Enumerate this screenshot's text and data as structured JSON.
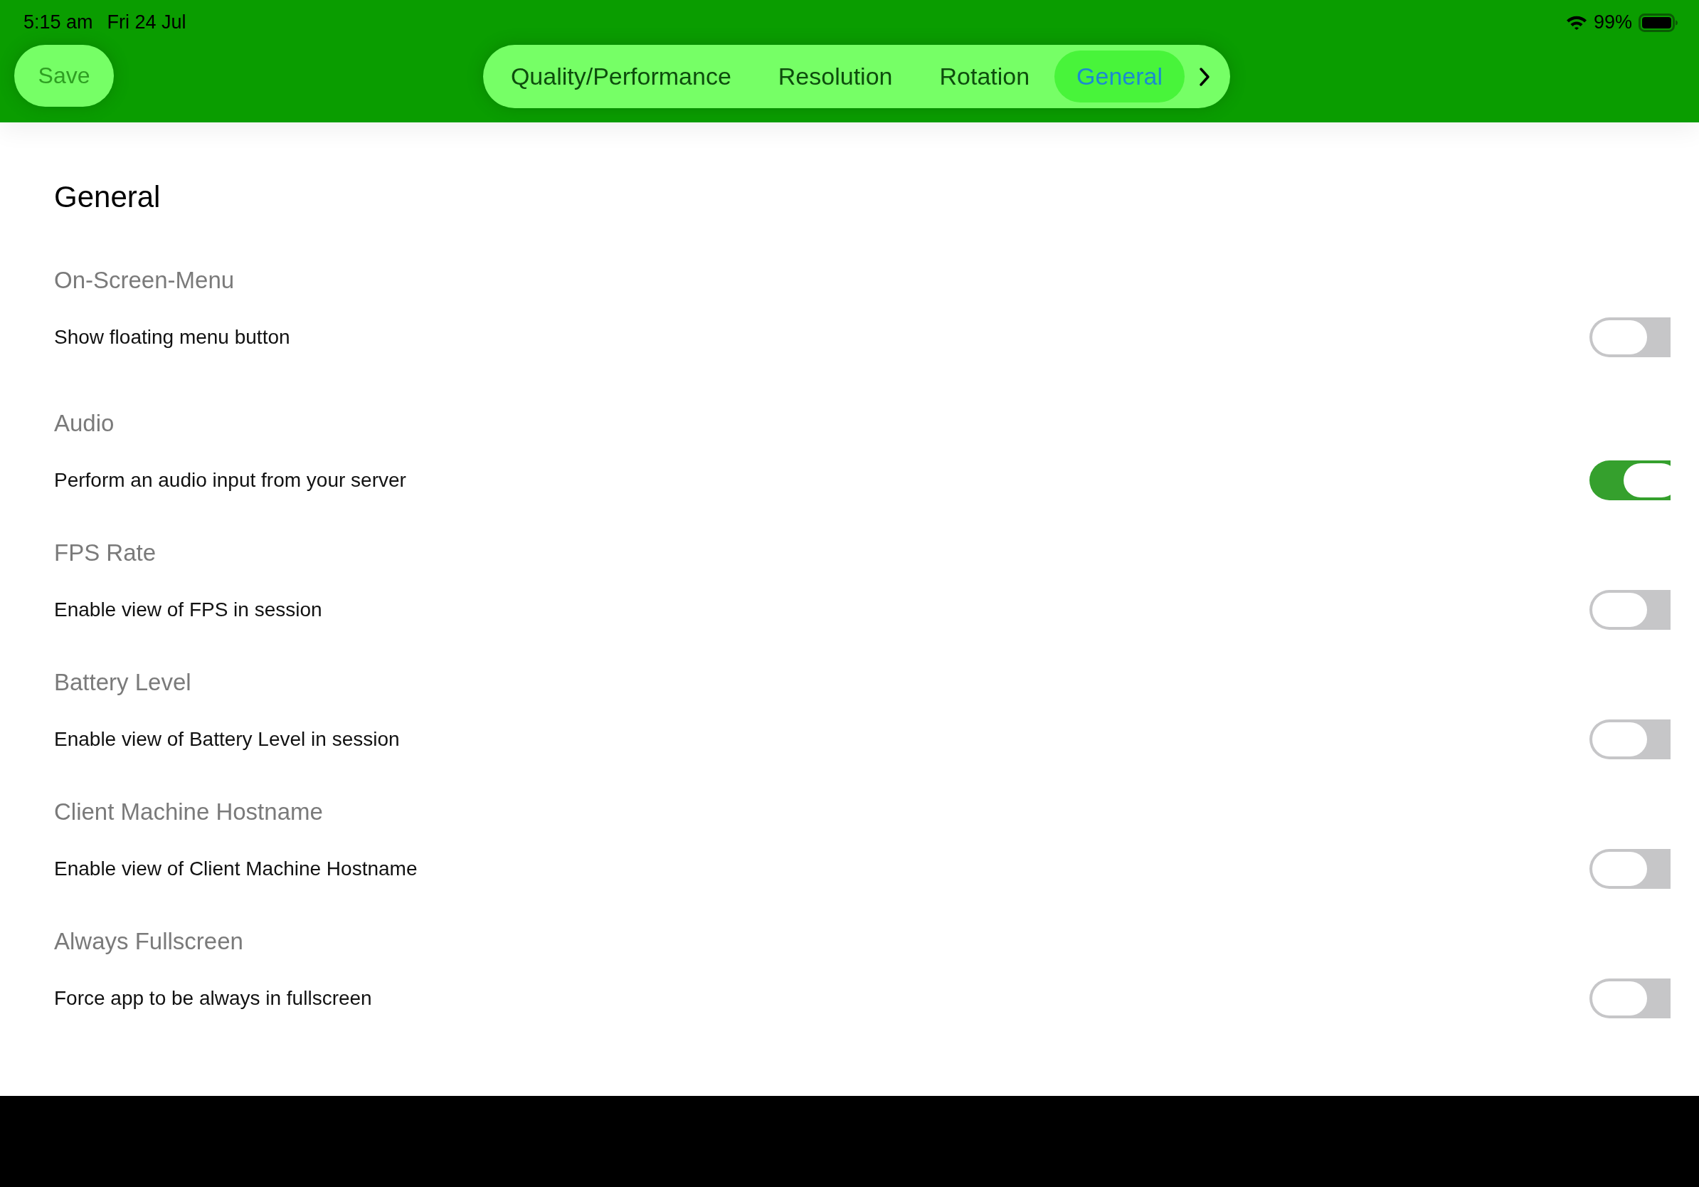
{
  "status_bar": {
    "time": "5:15 am",
    "date": "Fri 24 Jul",
    "battery_percent": "99%"
  },
  "toolbar": {
    "save_button": {
      "label": "Save",
      "disabled": true
    },
    "tabs": [
      {
        "label": "Quality/Performance",
        "selected": false
      },
      {
        "label": "Resolution",
        "selected": false
      },
      {
        "label": "Rotation",
        "selected": false
      },
      {
        "label": "General",
        "selected": true
      }
    ]
  },
  "page": {
    "title": "General",
    "sections": [
      {
        "heading": "On-Screen-Menu",
        "setting": {
          "label": "Show floating menu button",
          "on": false
        }
      },
      {
        "heading": "Audio",
        "setting": {
          "label": "Perform an audio input from your server",
          "on": true
        }
      },
      {
        "heading": "FPS Rate",
        "setting": {
          "label": "Enable view of FPS in session",
          "on": false
        }
      },
      {
        "heading": "Battery Level",
        "setting": {
          "label": "Enable view of Battery Level in session",
          "on": false
        }
      },
      {
        "heading": "Client Machine Hostname",
        "setting": {
          "label": "Enable view of Client Machine Hostname",
          "on": false
        }
      },
      {
        "heading": "Always Fullscreen",
        "setting": {
          "label": "Force app to be always in fullscreen",
          "on": false
        }
      }
    ]
  }
}
